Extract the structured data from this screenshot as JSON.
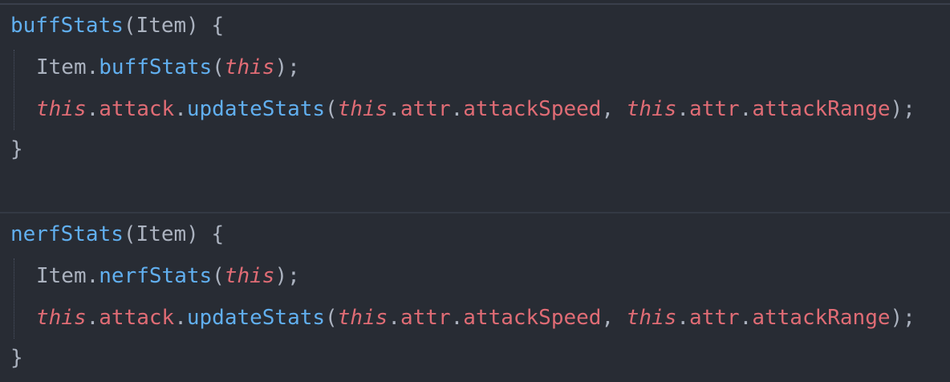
{
  "code": {
    "method1": {
      "name": "buffStats",
      "params": "(Item) {",
      "call_object": "Item",
      "call_method": "buffStats",
      "this_kw": "this",
      "attack": "attack",
      "update": "updateStats",
      "attr": "attr",
      "speed": "attackSpeed",
      "range": "attackRange",
      "close": "}"
    },
    "method2": {
      "name": "nerfStats",
      "params": "(Item) {",
      "call_object": "Item",
      "call_method": "nerfStats",
      "this_kw": "this",
      "attack": "attack",
      "update": "updateStats",
      "attr": "attr",
      "speed": "attackSpeed",
      "range": "attackRange",
      "close": "}"
    }
  },
  "colors": {
    "background": "#282c34",
    "function": "#61afef",
    "keyword": "#e06c75",
    "text": "#abb2bf"
  }
}
